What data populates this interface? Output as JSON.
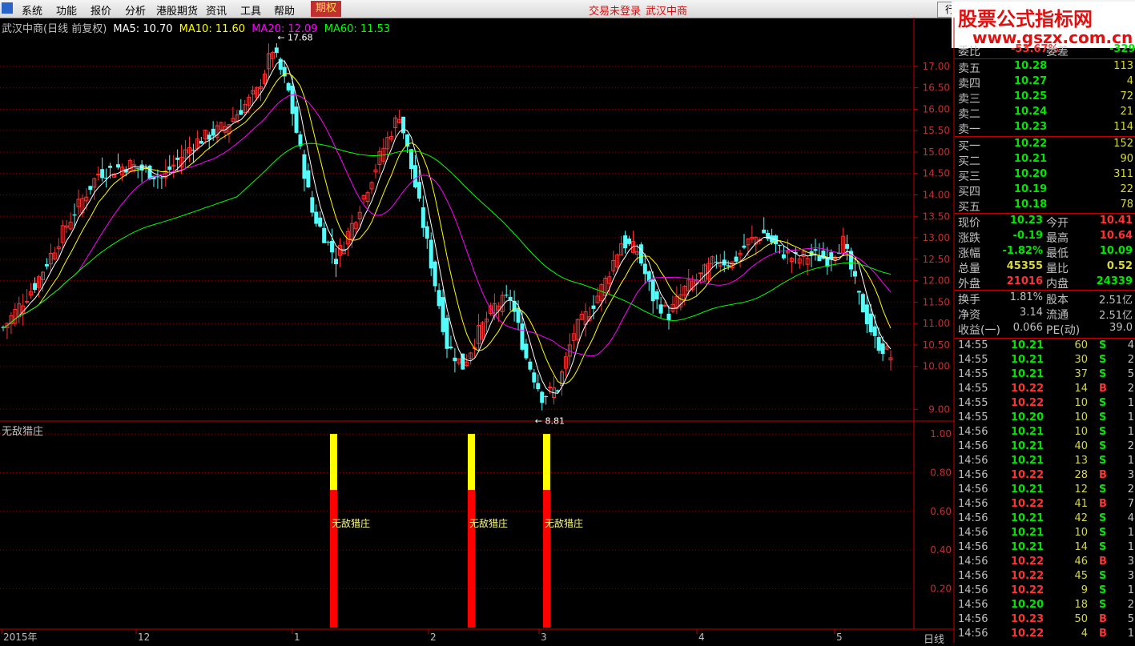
{
  "menu": {
    "items": [
      "系统",
      "功能",
      "报价",
      "分析",
      "港股期货",
      "资讯",
      "工具",
      "帮助"
    ],
    "highlight": "期权",
    "login_status": "交易未登录",
    "stock_name": "武汉中商",
    "trade_button": "行"
  },
  "watermark": {
    "line1": "股票公式指标网",
    "line2": "www.gszx.com.cn"
  },
  "chart_header": {
    "title": "武汉中商(日线 前复权)",
    "ma5": "MA5: 10.70",
    "ma10": "MA10: 11.60",
    "ma20": "MA20: 12.09",
    "ma60": "MA60: 11.53"
  },
  "colors": {
    "up": "#ff3232",
    "down": "#54fcfc",
    "ma5": "#ffffff",
    "ma10": "#ffff00",
    "ma20": "#ff00ff",
    "ma60": "#00ff00",
    "grid": "#8b0000"
  },
  "chart_data": [
    {
      "type": "candlestick",
      "title": "武汉中商(日线 前复权)",
      "ylim": [
        8.8,
        17.8
      ],
      "yticks": [
        "17.00",
        "16.50",
        "16.00",
        "15.50",
        "15.00",
        "14.50",
        "14.00",
        "13.50",
        "13.00",
        "12.50",
        "12.00",
        "11.50",
        "11.00",
        "10.50",
        "10.00",
        "9.00"
      ],
      "annotations": {
        "high": "17.68",
        "low": "8.81"
      },
      "xlabels": [
        "2015年",
        "12",
        "1",
        "2",
        "3",
        "4",
        "5"
      ]
    },
    {
      "type": "bar",
      "title": "无敌猎庄",
      "ylim": [
        0,
        1.05
      ],
      "yticks": [
        "1.00",
        "0.80",
        "0.60",
        "0.40",
        "0.20"
      ],
      "signals": [
        {
          "label": "无敌猎庄",
          "value": 1.0
        },
        {
          "label": "无敌猎庄",
          "value": 1.0
        },
        {
          "label": "无敌猎庄",
          "value": 1.0
        }
      ]
    }
  ],
  "quote": {
    "weibi_label": "委比",
    "weibi_value": "-53.67%",
    "weicha_label": "委差",
    "weicha_value": "-329",
    "sell": [
      {
        "label": "卖五",
        "price": "10.28",
        "vol": "113"
      },
      {
        "label": "卖四",
        "price": "10.27",
        "vol": "4"
      },
      {
        "label": "卖三",
        "price": "10.25",
        "vol": "72"
      },
      {
        "label": "卖二",
        "price": "10.24",
        "vol": "21"
      },
      {
        "label": "卖一",
        "price": "10.23",
        "vol": "114"
      }
    ],
    "buy": [
      {
        "label": "买一",
        "price": "10.22",
        "vol": "152"
      },
      {
        "label": "买二",
        "price": "10.21",
        "vol": "90"
      },
      {
        "label": "买三",
        "price": "10.20",
        "vol": "311"
      },
      {
        "label": "买四",
        "price": "10.19",
        "vol": "22"
      },
      {
        "label": "买五",
        "price": "10.18",
        "vol": "78"
      }
    ],
    "stats": [
      {
        "l1": "现价",
        "v1": "10.23",
        "l2": "今开",
        "v2": "10.41"
      },
      {
        "l1": "涨跌",
        "v1": "-0.19",
        "l2": "最高",
        "v2": "10.64"
      },
      {
        "l1": "涨幅",
        "v1": "-1.82%",
        "l2": "最低",
        "v2": "10.09"
      },
      {
        "l1": "总量",
        "v1": "45355",
        "l2": "量比",
        "v2": "0.52"
      },
      {
        "l1": "外盘",
        "v1": "21016",
        "l2": "内盘",
        "v2": "24339"
      }
    ],
    "stats2": [
      {
        "l1": "换手",
        "v1": "1.81%",
        "l2": "股本",
        "v2": "2.51亿"
      },
      {
        "l1": "净资",
        "v1": "3.14",
        "l2": "流通",
        "v2": "2.51亿"
      },
      {
        "l1": "收益(一)",
        "v1": "0.066",
        "l2": "PE(动)",
        "v2": "39.0"
      }
    ]
  },
  "ticks": [
    {
      "t": "14:55",
      "p": "10.21",
      "v": "60",
      "s": "S",
      "n": "4"
    },
    {
      "t": "14:55",
      "p": "10.21",
      "v": "30",
      "s": "S",
      "n": "2"
    },
    {
      "t": "14:55",
      "p": "10.21",
      "v": "37",
      "s": "S",
      "n": "5"
    },
    {
      "t": "14:55",
      "p": "10.22",
      "v": "14",
      "s": "B",
      "n": "2"
    },
    {
      "t": "14:55",
      "p": "10.22",
      "v": "10",
      "s": "S",
      "n": "1"
    },
    {
      "t": "14:55",
      "p": "10.20",
      "v": "10",
      "s": "S",
      "n": "1"
    },
    {
      "t": "14:56",
      "p": "10.21",
      "v": "10",
      "s": "S",
      "n": "1"
    },
    {
      "t": "14:56",
      "p": "10.21",
      "v": "40",
      "s": "S",
      "n": "2"
    },
    {
      "t": "14:56",
      "p": "10.21",
      "v": "13",
      "s": "S",
      "n": "1"
    },
    {
      "t": "14:56",
      "p": "10.22",
      "v": "28",
      "s": "B",
      "n": "3"
    },
    {
      "t": "14:56",
      "p": "10.21",
      "v": "12",
      "s": "S",
      "n": "2"
    },
    {
      "t": "14:56",
      "p": "10.22",
      "v": "41",
      "s": "B",
      "n": "7"
    },
    {
      "t": "14:56",
      "p": "10.21",
      "v": "42",
      "s": "S",
      "n": "4"
    },
    {
      "t": "14:56",
      "p": "10.21",
      "v": "10",
      "s": "S",
      "n": "1"
    },
    {
      "t": "14:56",
      "p": "10.21",
      "v": "14",
      "s": "S",
      "n": "1"
    },
    {
      "t": "14:56",
      "p": "10.22",
      "v": "46",
      "s": "B",
      "n": "3"
    },
    {
      "t": "14:56",
      "p": "10.22",
      "v": "45",
      "s": "S",
      "n": "3"
    },
    {
      "t": "14:56",
      "p": "10.22",
      "v": "9",
      "s": "S",
      "n": "1"
    },
    {
      "t": "14:56",
      "p": "10.20",
      "v": "18",
      "s": "S",
      "n": "2"
    },
    {
      "t": "14:56",
      "p": "10.23",
      "v": "50",
      "s": "B",
      "n": "5"
    },
    {
      "t": "14:56",
      "p": "10.22",
      "v": "4",
      "s": "B",
      "n": "1"
    }
  ],
  "period_label": "日线"
}
